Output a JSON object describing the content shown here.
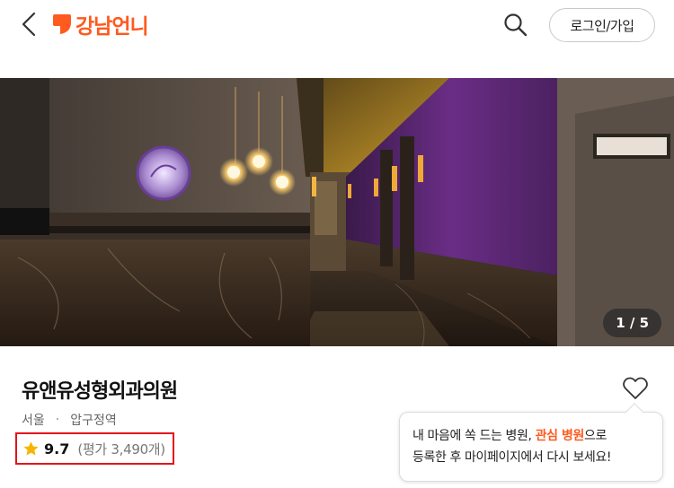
{
  "header": {
    "logo_text": "강남언니",
    "login_label": "로그인/가입",
    "brand_color": "#ff5a1f"
  },
  "icons": {
    "back": "chevron-left-icon",
    "search": "search-icon",
    "heart": "heart-outline-icon",
    "star": "star-icon"
  },
  "hero": {
    "counter": "1 / 5"
  },
  "clinic": {
    "name": "유앤유성형외과의원",
    "region": "서울",
    "separator": "·",
    "area": "압구정역",
    "score": "9.7",
    "review_label": "(평가 3,490개)"
  },
  "tooltip": {
    "line1_before": "내 마음에 쏙 드는 병원, ",
    "line1_highlight": "관심 병원",
    "line1_after": "으로",
    "line2": "등록한 후 마이페이지에서 다시 보세요!"
  }
}
